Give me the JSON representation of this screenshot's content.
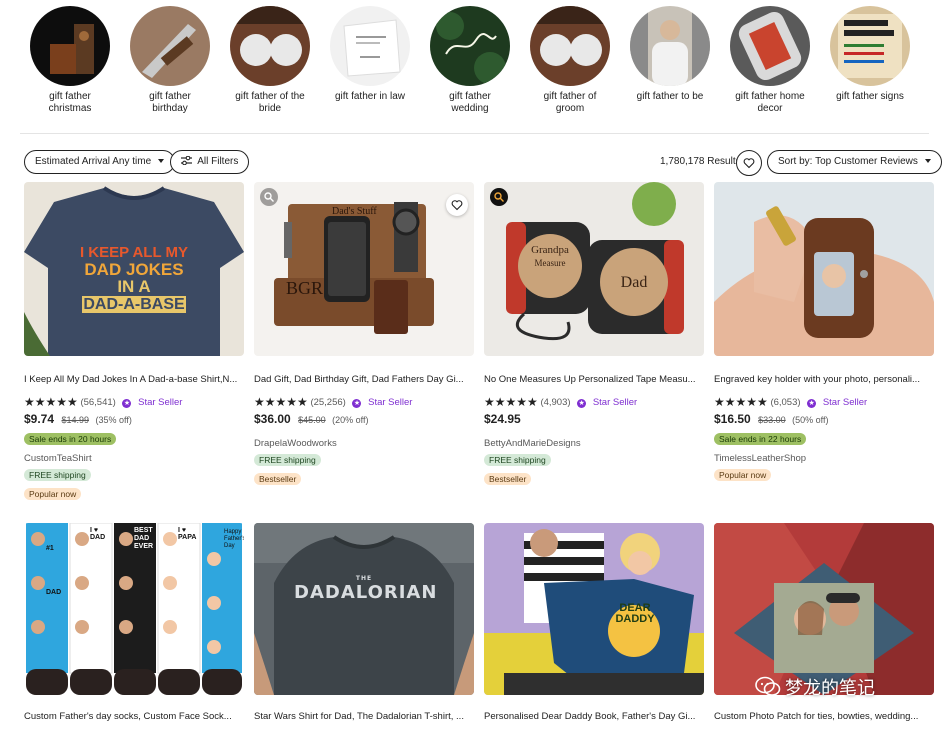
{
  "categories": [
    {
      "label": "gift father christmas"
    },
    {
      "label": "gift father birthday"
    },
    {
      "label": "gift father of the bride"
    },
    {
      "label": "gift father in law"
    },
    {
      "label": "gift father wedding"
    },
    {
      "label": "gift father of groom"
    },
    {
      "label": "gift father to be"
    },
    {
      "label": "gift father home decor"
    },
    {
      "label": "gift father signs"
    }
  ],
  "toolbar": {
    "arrival_label": "Estimated Arrival",
    "arrival_value": "Any time",
    "filters_label": "All Filters",
    "results": "1,780,178 Results",
    "sort_prefix": "Sort by:",
    "sort_value": "Top Customer Reviews"
  },
  "listings": [
    {
      "title": "I Keep All My Dad Jokes In A Dad-a-base Shirt,N...",
      "stars": "★★★★★",
      "reviews": "(56,541)",
      "star_seller": "Star Seller",
      "price": "$9.74",
      "old_price": "$14.99",
      "discount": "(35% off)",
      "sale": "Sale ends in 20 hours",
      "shop": "CustomTeaShirt",
      "shipping": "FREE shipping",
      "tag": "Popular now",
      "image_text": [
        "I KEEP ALL MY",
        "DAD JOKES",
        "IN A",
        "DAD-A-BASE"
      ]
    },
    {
      "title": "Dad Gift, Dad Birthday Gift, Dad Fathers Day Gi...",
      "stars": "★★★★★",
      "reviews": "(25,256)",
      "star_seller": "Star Seller",
      "price": "$36.00",
      "old_price": "$45.00",
      "discount": "(20% off)",
      "shop": "DrapelaWoodworks",
      "shipping": "FREE shipping",
      "tag": "Bestseller",
      "image_text": [
        "Dad's Stuff",
        "BGR"
      ]
    },
    {
      "title": "No One Measures Up Personalized Tape Measu...",
      "stars": "★★★★★",
      "reviews": "(4,903)",
      "star_seller": "Star Seller",
      "price": "$24.95",
      "shop": "BettyAndMarieDesigns",
      "shipping": "FREE shipping",
      "tag": "Bestseller",
      "image_text": [
        "Grandpa",
        "Measure",
        "Dad"
      ]
    },
    {
      "title": "Engraved key holder with your photo, personali...",
      "stars": "★★★★★",
      "reviews": "(6,053)",
      "star_seller": "Star Seller",
      "price": "$16.50",
      "old_price": "$33.00",
      "discount": "(50% off)",
      "sale": "Sale ends in 22 hours",
      "shop": "TimelessLeatherShop",
      "tag": "Popular now"
    },
    {
      "title": "Custom Father's day socks, Custom Face Sock...",
      "image_text": [
        "#1 DAD",
        "I ♥ DAD",
        "BEST DAD EVER",
        "I ♥ PAPA",
        "Happy Father's Day"
      ]
    },
    {
      "title": "Star Wars Shirt for Dad, The Dadalorian T-shirt, ...",
      "image_text": [
        "THE",
        "DADALORIAN"
      ]
    },
    {
      "title": "Personalised Dear Daddy Book, Father's Day Gi...",
      "image_text": [
        "DEAR DADDY"
      ]
    },
    {
      "title": "Custom Photo Patch for ties, bowties, wedding..."
    }
  ],
  "watermark": "梦龙的笔记",
  "colors": {
    "star_seller": "#7f2fd1",
    "sale_badge": "#9ec063",
    "shipping_badge": "#d4e9d7",
    "bestseller_badge": "#fde3c7"
  },
  "icons": [
    "heart-icon",
    "filter-icon",
    "chevron-down-icon",
    "magnifier-icon",
    "star-seller-badge-icon",
    "wechat-icon"
  ]
}
